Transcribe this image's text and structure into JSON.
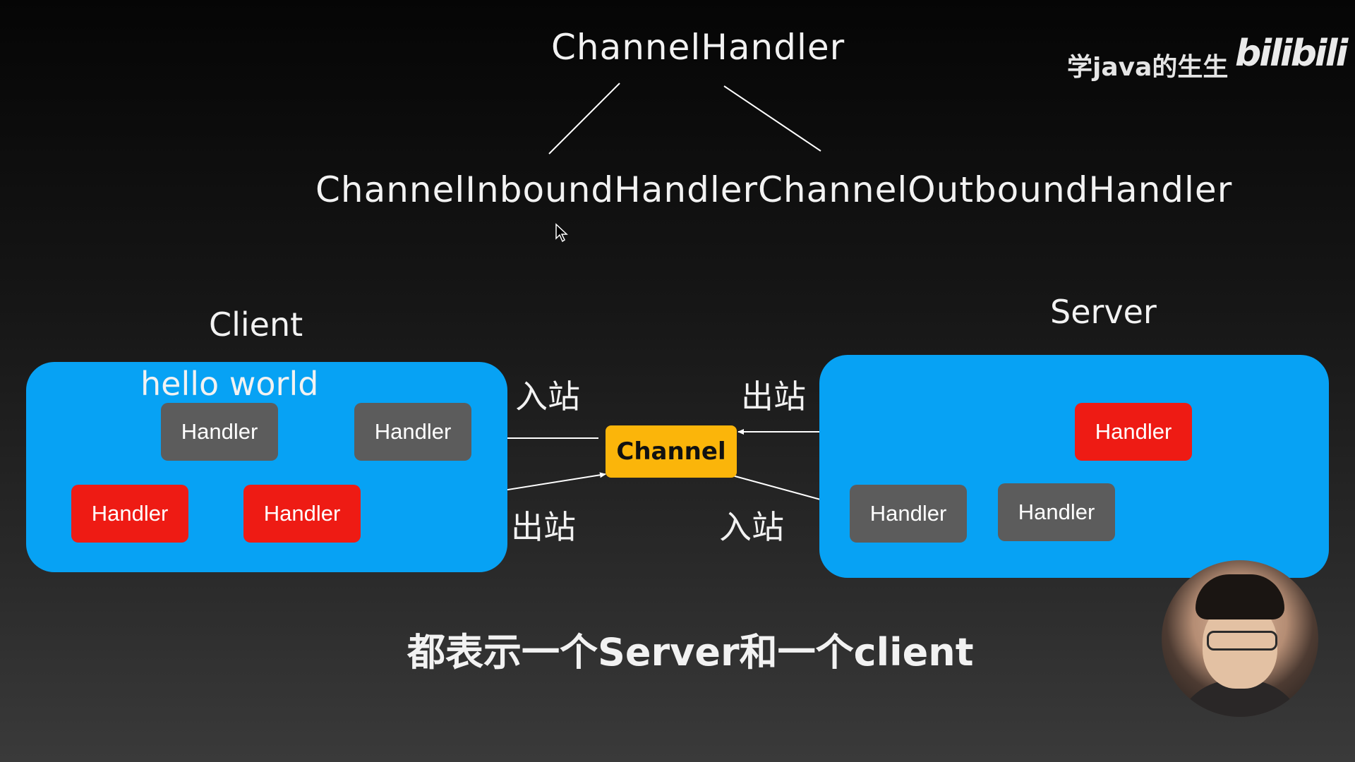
{
  "hierarchy": {
    "root": "ChannelHandler",
    "inbound": "ChannelInboundHandler",
    "outbound": "ChannelOutboundHandler"
  },
  "client": {
    "label": "Client",
    "message": "hello world",
    "inbound_label": "入站",
    "outbound_label": "出站",
    "handlers": [
      "Handler",
      "Handler",
      "Handler",
      "Handler"
    ]
  },
  "server": {
    "label": "Server",
    "inbound_label": "入站",
    "outbound_label": "出站",
    "handlers": [
      "Handler",
      "Handler",
      "Handler"
    ]
  },
  "channel": {
    "label": "Channel"
  },
  "caption": "都表示一个Server和一个client",
  "watermark": {
    "author": "学java的生生",
    "brand": "bilibili"
  },
  "colors": {
    "panel": "#07a2f4",
    "inbound_handler": "#5c5c5c",
    "outbound_handler": "#ee1b14",
    "channel": "#fbb50a"
  }
}
